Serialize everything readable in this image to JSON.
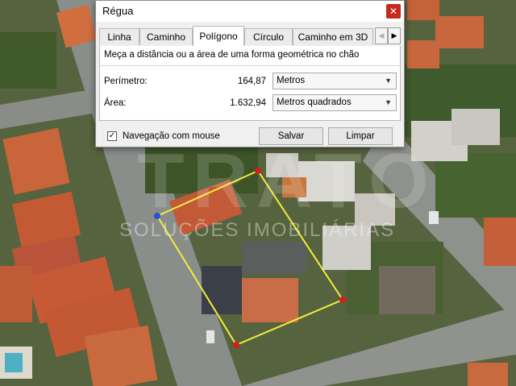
{
  "window": {
    "title": "Régua",
    "close_symbol": "✕"
  },
  "tabs": [
    {
      "label": "Linha"
    },
    {
      "label": "Caminho"
    },
    {
      "label": "Polígono"
    },
    {
      "label": "Círculo"
    },
    {
      "label": "Caminho em 3D"
    }
  ],
  "active_tab": "Polígono",
  "tab_nav": {
    "prev": "◀",
    "next": "▶"
  },
  "panel": {
    "description": "Meça a distância ou a área de uma forma geométrica no chão",
    "perimeter": {
      "label": "Perímetro:",
      "value": "164,87",
      "unit": "Metros"
    },
    "area": {
      "label": "Área:",
      "value": "1.632,94",
      "unit": "Metros quadrados"
    },
    "dropdown_arrow": "▼"
  },
  "footer": {
    "mouse_nav_label": "Navegação com mouse",
    "mouse_nav_checked": true,
    "check_mark": "✓",
    "save_label": "Salvar",
    "clear_label": "Limpar"
  },
  "watermark": {
    "main": "TRATO",
    "sub": "SOLUÇÕES IMOBILIÁRIAS"
  },
  "colors": {
    "polygon_line": "#f2ee3a",
    "vertex": "#d81b1b",
    "active_vertex": "#2a4fd8",
    "close_button": "#c42b1c"
  }
}
